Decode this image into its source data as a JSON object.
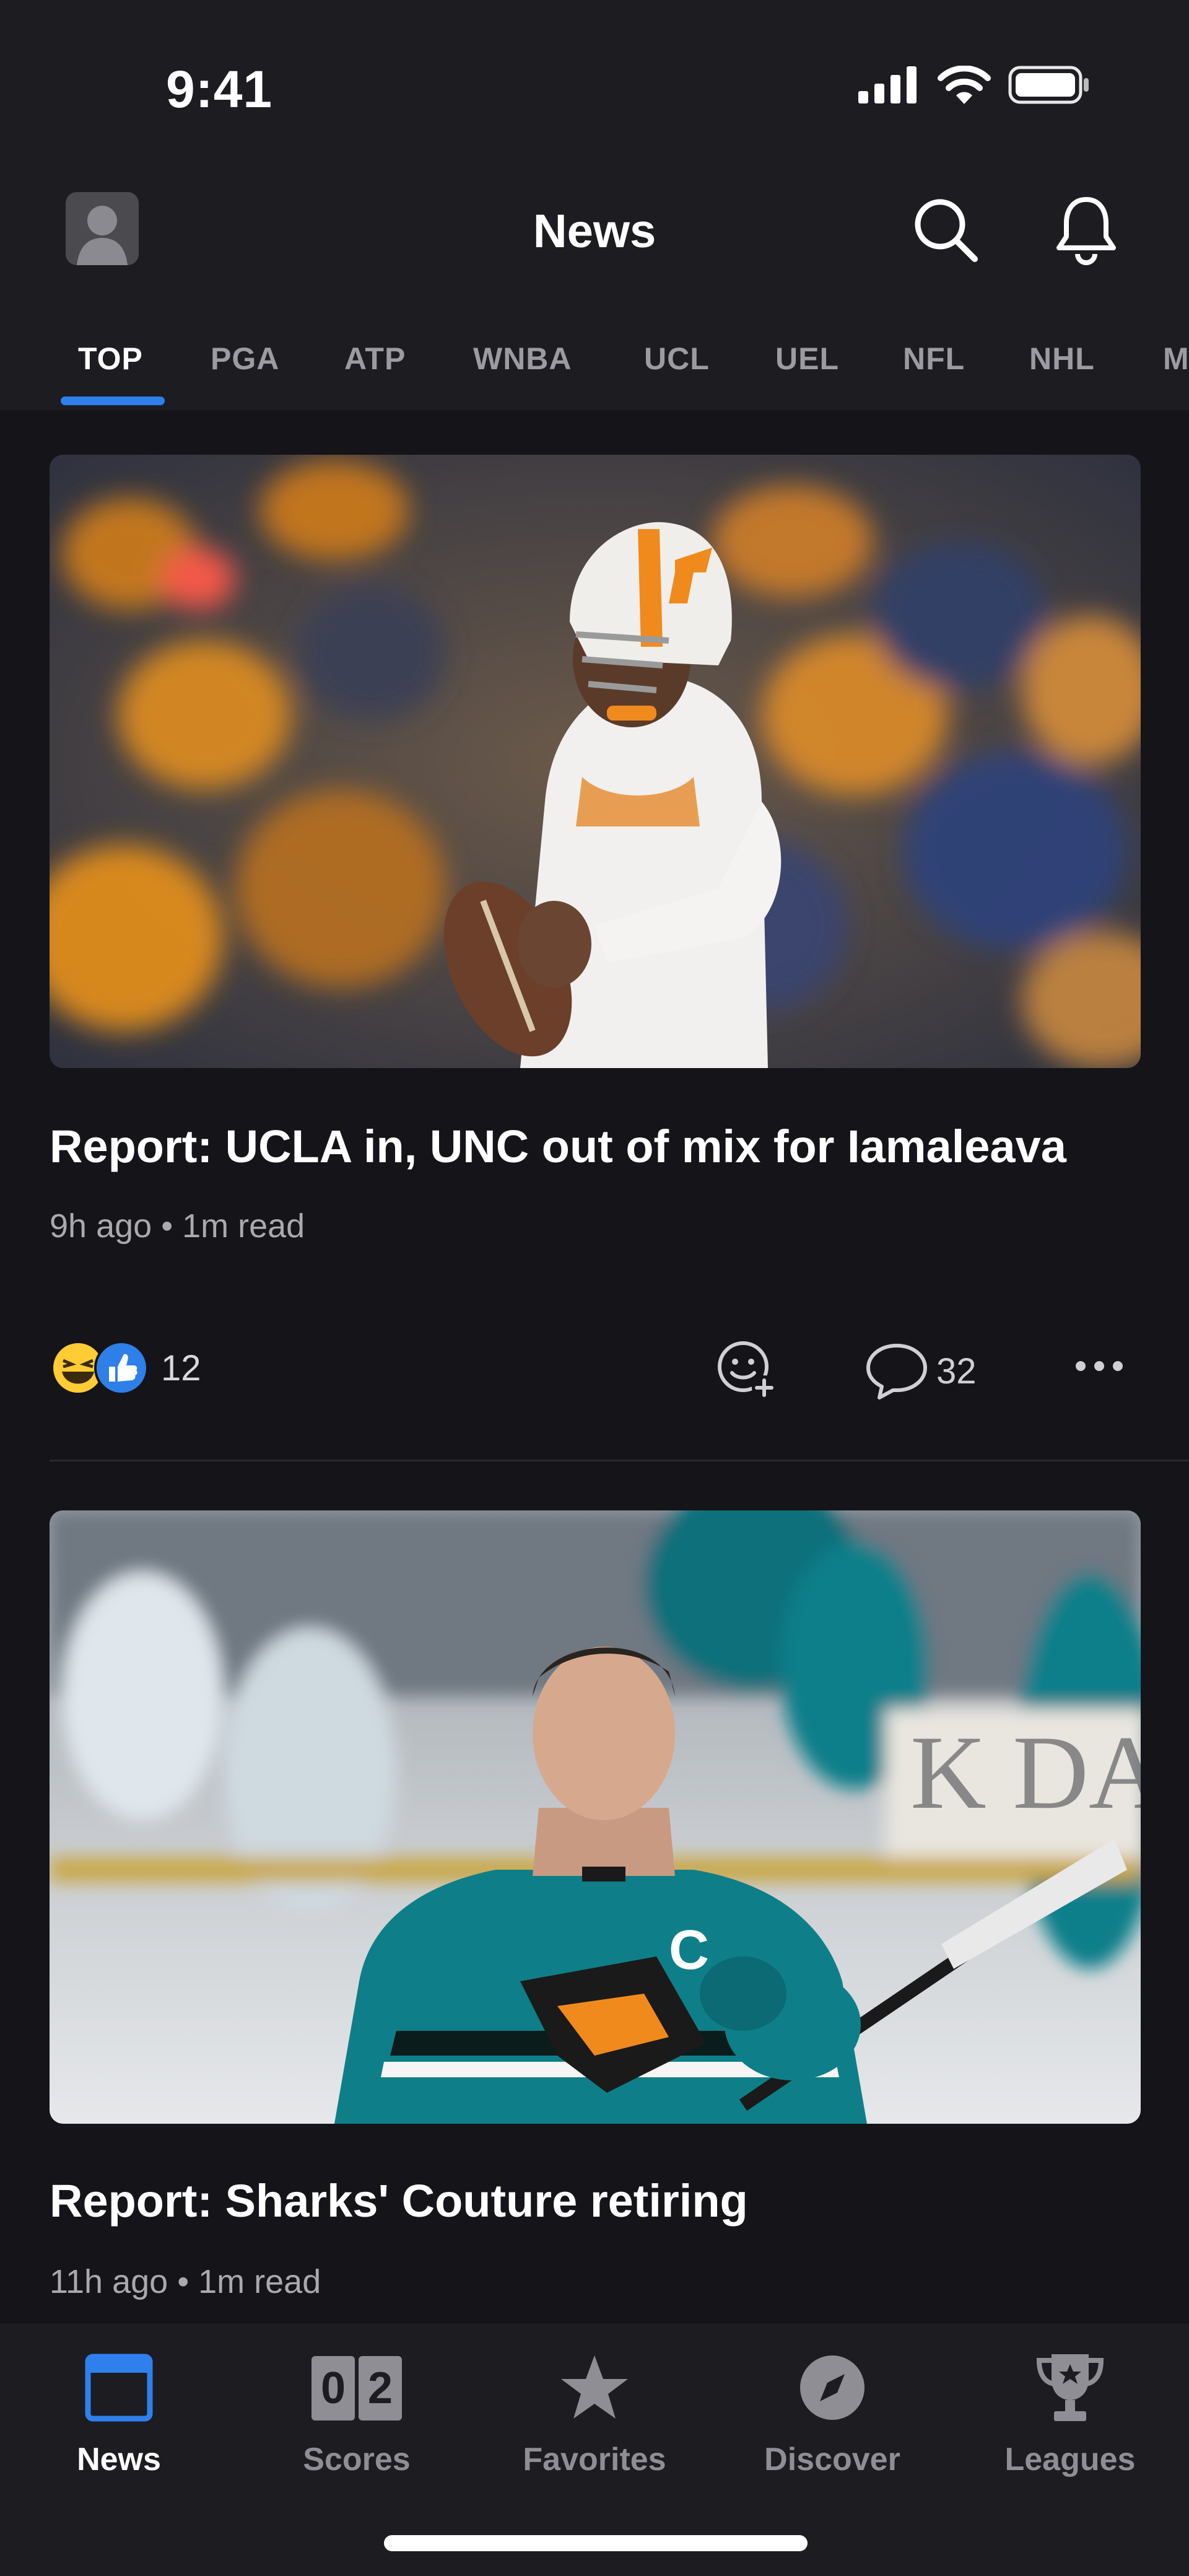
{
  "status_bar": {
    "time": "9:41"
  },
  "header": {
    "title": "News"
  },
  "tabs": [
    {
      "label": "TOP",
      "active": true
    },
    {
      "label": "PGA"
    },
    {
      "label": "ATP"
    },
    {
      "label": "WNBA"
    },
    {
      "label": "UCL"
    },
    {
      "label": "UEL"
    },
    {
      "label": "NFL"
    },
    {
      "label": "NHL"
    },
    {
      "label": "M"
    }
  ],
  "feed": [
    {
      "headline": "Report: UCLA in, UNC out of mix for Iamaleava",
      "time": "9h ago",
      "read": "1m read",
      "reaction_count": "12",
      "comment_count": "32",
      "reaction_icons": [
        "laughing-emoji-icon",
        "thumbs-up-icon"
      ]
    },
    {
      "headline": "Report: Sharks' Couture retiring",
      "time": "11h ago",
      "read": "1m read"
    }
  ],
  "bottom_nav": [
    {
      "label": "News",
      "icon": "news-icon",
      "active": true
    },
    {
      "label": "Scores",
      "icon": "scores-icon",
      "score_digits": [
        "0",
        "2"
      ]
    },
    {
      "label": "Favorites",
      "icon": "star-icon"
    },
    {
      "label": "Discover",
      "icon": "compass-icon"
    },
    {
      "label": "Leagues",
      "icon": "trophy-icon"
    }
  ],
  "colors": {
    "accent": "#2f80ed",
    "background": "#151419",
    "header": "#1d1c21",
    "meta_text": "#a9a9ae"
  }
}
